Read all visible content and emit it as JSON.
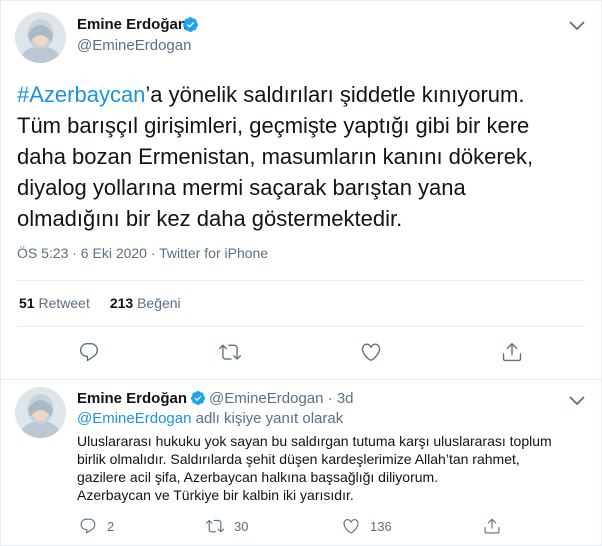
{
  "tweet": {
    "author_name": "Emine Erdoğan",
    "author_handle": "@EmineErdogan",
    "hashtag": "#Azerbaycan",
    "text_line1_rest": "’a yönelik saldırıları şiddetle kınıyorum.",
    "text_line2": "Tüm barışçıl girişimleri, geçmişte yaptığı gibi bir kere",
    "text_line3": "daha bozan Ermenistan, masumların kanını dökerek,",
    "text_line4": "diyalog yollarına mermi saçarak barıştan yana",
    "text_line5": "olmadığını bir kez daha göstermektedir.",
    "timestamp": "ÖS 5:23 · 6 Eki 2020 · Twitter for iPhone",
    "retweet_count": "51",
    "retweet_label": "Retweet",
    "like_count": "213",
    "like_label": "Beğeni"
  },
  "reply": {
    "author_name": "Emine Erdoğan",
    "author_handle": "@EmineErdogan",
    "time": "· 3d",
    "reply_to_mention": "@EmineErdogan",
    "reply_to_suffix": " adlı kişiye yanıt olarak",
    "text_line1": "Uluslararası hukuku yok sayan bu saldırgan tutuma karşı uluslararası toplum",
    "text_line2": "birlik olmalıdır. Saldırılarda şehit düşen kardeşlerimize Allah’tan rahmet,",
    "text_line3": "gazilere acil şifa, Azerbaycan halkına başsağlığı diliyorum.",
    "text_line4": "Azerbaycan ve Türkiye bir kalbin iki yarısıdır.",
    "reply_count": "2",
    "retweet_count": "30",
    "like_count": "136"
  },
  "icons": {
    "verified": "verified-badge-icon",
    "caret": "chevron-down-icon",
    "reply": "reply-icon",
    "retweet": "retweet-icon",
    "like": "heart-icon",
    "share": "share-icon"
  },
  "colors": {
    "link_blue": "#1b95e0",
    "secondary_text": "#5b7083",
    "primary_text": "#0f1419",
    "divider": "#e6ecf0"
  }
}
